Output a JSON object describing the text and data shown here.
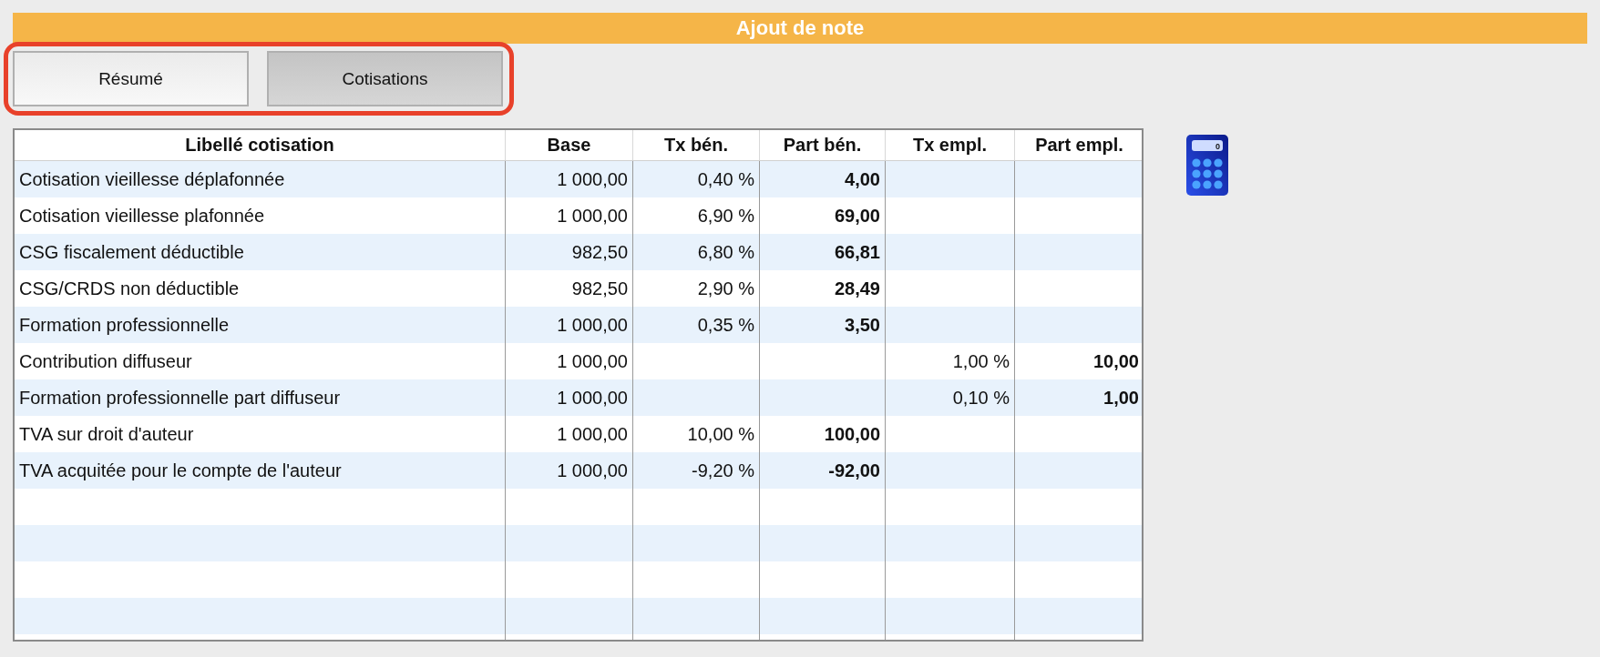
{
  "title": "Ajout de note",
  "tabs": [
    {
      "label": "Résumé",
      "selected": false
    },
    {
      "label": "Cotisations",
      "selected": true
    }
  ],
  "table": {
    "columns": [
      {
        "label": "Libellé cotisation",
        "kind": "text"
      },
      {
        "label": "Base",
        "kind": "number"
      },
      {
        "label": "Tx bén.",
        "kind": "number"
      },
      {
        "label": "Part bén.",
        "kind": "amount"
      },
      {
        "label": "Tx empl.",
        "kind": "number"
      },
      {
        "label": "Part empl.",
        "kind": "amount"
      }
    ],
    "rows": [
      {
        "cells": [
          "Cotisation vieillesse déplafonnée",
          "1 000,00",
          "0,40 %",
          "4,00",
          null,
          null
        ]
      },
      {
        "cells": [
          "Cotisation vieillesse plafonnée",
          "1 000,00",
          "6,90 %",
          "69,00",
          null,
          null
        ]
      },
      {
        "cells": [
          "CSG fiscalement déductible",
          "982,50",
          "6,80 %",
          "66,81",
          null,
          null
        ]
      },
      {
        "cells": [
          "CSG/CRDS non déductible",
          "982,50",
          "2,90 %",
          "28,49",
          null,
          null
        ]
      },
      {
        "cells": [
          "Formation professionnelle",
          "1 000,00",
          "0,35 %",
          "3,50",
          null,
          null
        ]
      },
      {
        "cells": [
          "Contribution diffuseur",
          "1 000,00",
          null,
          null,
          "1,00 %",
          "10,00"
        ]
      },
      {
        "cells": [
          "Formation professionnelle part diffuseur",
          "1 000,00",
          null,
          null,
          "0,10 %",
          "1,00"
        ]
      },
      {
        "cells": [
          "TVA sur droit d'auteur",
          "1 000,00",
          "10,00 %",
          "100,00",
          null,
          null
        ]
      },
      {
        "cells": [
          "TVA acquitée pour le compte de l'auteur",
          "1 000,00",
          "-9,20 %",
          "-92,00",
          null,
          null
        ]
      }
    ]
  },
  "calculator": {
    "display": "0"
  }
}
